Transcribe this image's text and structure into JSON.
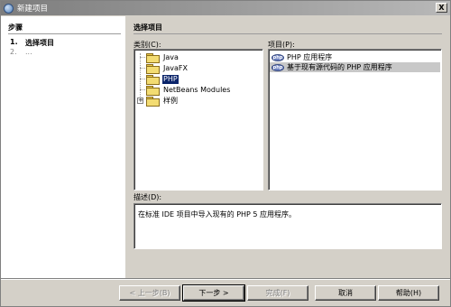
{
  "window": {
    "title": "新建项目",
    "close_glyph": "X"
  },
  "steps": {
    "heading": "步骤",
    "items": [
      {
        "num": "1.",
        "label": "选择项目"
      },
      {
        "num": "2.",
        "label": "..."
      }
    ]
  },
  "main": {
    "heading": "选择项目",
    "categories_label": "类别(C):",
    "projects_label": "项目(P):",
    "description_label": "描述(D):",
    "description_text": "在标准 IDE 项目中导入现有的 PHP 5 应用程序。"
  },
  "categories": [
    {
      "label": "Java",
      "selected": false,
      "expandable": false
    },
    {
      "label": "JavaFX",
      "selected": false,
      "expandable": false
    },
    {
      "label": "PHP",
      "selected": true,
      "expandable": false
    },
    {
      "label": "NetBeans Modules",
      "selected": false,
      "expandable": false
    },
    {
      "label": "样例",
      "selected": false,
      "expandable": true
    }
  ],
  "projects": [
    {
      "label": "PHP 应用程序",
      "selected": false,
      "icon": "php-icon"
    },
    {
      "label": "基于现有源代码的 PHP 应用程序",
      "selected": true,
      "icon": "php-icon"
    }
  ],
  "buttons": {
    "back": "< 上一步(B)",
    "next": "下一步 >",
    "finish": "完成(F)",
    "cancel": "取消",
    "help": "帮助(H)"
  }
}
